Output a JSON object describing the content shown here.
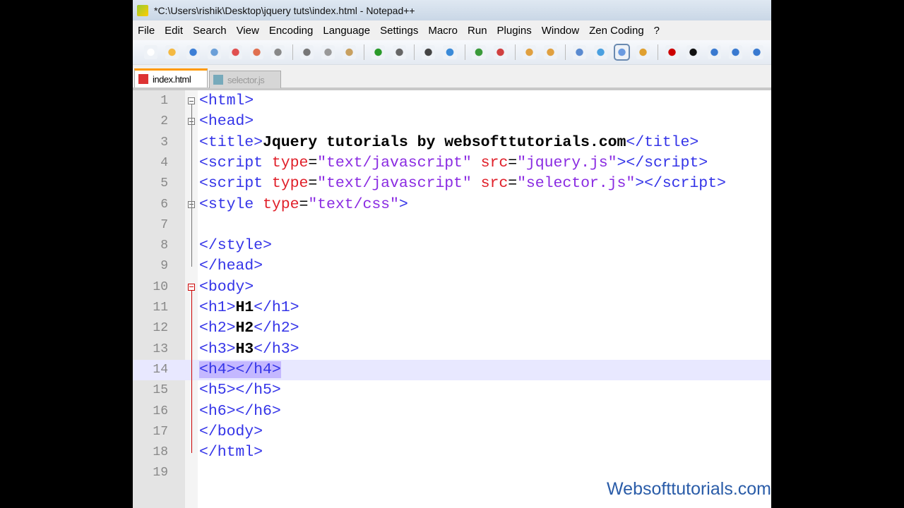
{
  "window": {
    "title": "*C:\\Users\\rishik\\Desktop\\jquery tuts\\index.html - Notepad++"
  },
  "menu": [
    "File",
    "Edit",
    "Search",
    "View",
    "Encoding",
    "Language",
    "Settings",
    "Macro",
    "Run",
    "Plugins",
    "Window",
    "Zen Coding",
    "?"
  ],
  "toolbar_icons": [
    "new-file",
    "open",
    "save",
    "save-all",
    "close",
    "close-all",
    "print",
    "cut",
    "copy",
    "paste",
    "undo",
    "redo",
    "find",
    "replace",
    "zoom-in",
    "zoom-out",
    "sync-v",
    "sync-h",
    "wrap",
    "all-chars",
    "indent-guide",
    "udl",
    "record-macro",
    "stop-record",
    "play-macro",
    "run-macro-multiple",
    "save-macro"
  ],
  "tabs": [
    {
      "label": "index.html",
      "active": true
    },
    {
      "label": "selector.js",
      "active": false
    }
  ],
  "current_line": 14,
  "lines": [
    [
      [
        "tag",
        "<html>"
      ]
    ],
    [
      [
        "tag",
        "<head>"
      ]
    ],
    [
      [
        "tag",
        "<title>"
      ],
      [
        "txt",
        "Jquery tutorials by websofttutorials.com"
      ],
      [
        "tag",
        "</title>"
      ]
    ],
    [
      [
        "tag",
        "<script "
      ],
      [
        "attr",
        "type"
      ],
      [
        "op",
        "="
      ],
      [
        "str",
        "\"text/javascript\""
      ],
      [
        "tag",
        " "
      ],
      [
        "attr",
        "src"
      ],
      [
        "op",
        "="
      ],
      [
        "str",
        "\"jquery.js\""
      ],
      [
        "tag",
        "></script>"
      ]
    ],
    [
      [
        "tag",
        "<script "
      ],
      [
        "attr",
        "type"
      ],
      [
        "op",
        "="
      ],
      [
        "str",
        "\"text/javascript\""
      ],
      [
        "tag",
        " "
      ],
      [
        "attr",
        "src"
      ],
      [
        "op",
        "="
      ],
      [
        "str",
        "\"selector.js\""
      ],
      [
        "tag",
        "></script>"
      ]
    ],
    [
      [
        "tag",
        "<style "
      ],
      [
        "attr",
        "type"
      ],
      [
        "op",
        "="
      ],
      [
        "str",
        "\"text/css\""
      ],
      [
        "tag",
        ">"
      ]
    ],
    [],
    [
      [
        "tag",
        "</style>"
      ]
    ],
    [
      [
        "tag",
        "</head>"
      ]
    ],
    [
      [
        "tag",
        "<body>"
      ]
    ],
    [
      [
        "tag",
        "<h1>"
      ],
      [
        "txt",
        "H1"
      ],
      [
        "tag",
        "</h1>"
      ]
    ],
    [
      [
        "tag",
        "<h2>"
      ],
      [
        "txt",
        "H2"
      ],
      [
        "tag",
        "</h2>"
      ]
    ],
    [
      [
        "tag",
        "<h3>"
      ],
      [
        "txt",
        "H3"
      ],
      [
        "tag",
        "</h3>"
      ]
    ],
    [
      [
        "sel",
        "<h4></h4>"
      ]
    ],
    [
      [
        "tag",
        "<h5></h5>"
      ]
    ],
    [
      [
        "tag",
        "<h6></h6>"
      ]
    ],
    [
      [
        "tag",
        "</body>"
      ]
    ],
    [
      [
        "tag",
        "</html>"
      ]
    ],
    []
  ],
  "fold_markers": [
    1,
    2,
    6,
    10
  ],
  "watermark": "Websofttutorials.com"
}
